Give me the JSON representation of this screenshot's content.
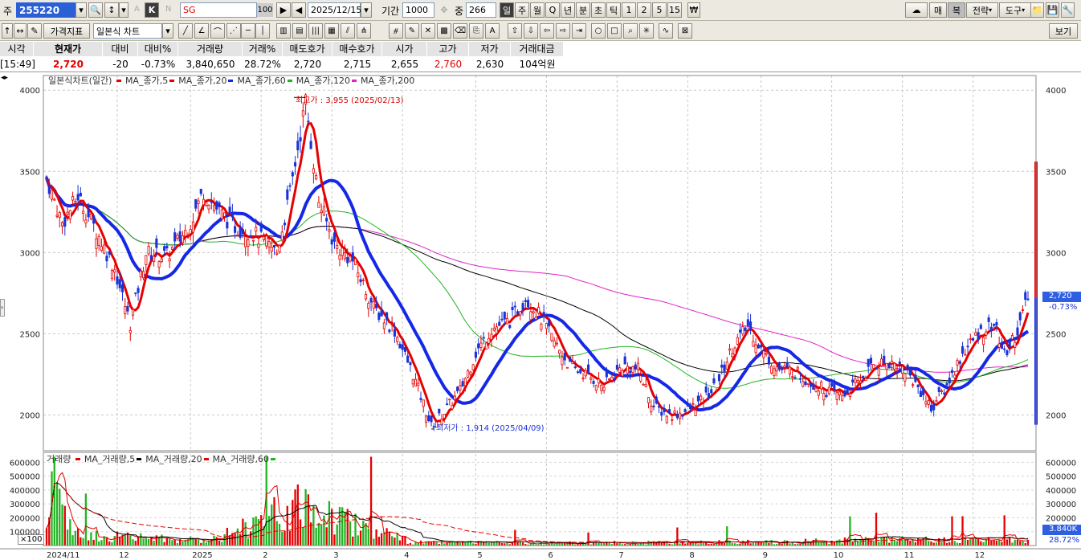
{
  "toolbar": {
    "market_label": "주",
    "code": "255220",
    "k_label": "K",
    "a_label": "A",
    "n_label": "N",
    "stock_name": "SG",
    "name_count": "100",
    "date": "2025/12/15",
    "period_label": "기간",
    "period": "1000",
    "middle_label": "중",
    "middle_value": "266",
    "periods": [
      "일",
      "주",
      "월",
      "Q",
      "년",
      "분",
      "초",
      "틱",
      "1",
      "2",
      "5",
      "15"
    ],
    "right_buttons": [
      "매",
      "복",
      "전략",
      "도구"
    ],
    "price_indicator_btn": "가격지표",
    "chart_type": "일본식 차트",
    "view_btn": "보기"
  },
  "quote": {
    "headers": [
      "시각",
      "현재가",
      "대비",
      "대비%",
      "거래량",
      "거래%",
      "매도호가",
      "매수호가",
      "시가",
      "고가",
      "저가",
      "거래대금"
    ],
    "values": [
      "[15:49]",
      "2,720",
      "-20",
      "-0.73%",
      "3,840,650",
      "28.72%",
      "2,720",
      "2,715",
      "2,655",
      "2,760",
      "2,630",
      "104억원"
    ]
  },
  "legend": {
    "title": "일본식차트(일간)",
    "items": [
      {
        "label": "MA_종가,5",
        "color": "#e60000"
      },
      {
        "label": "MA_종가,20",
        "color": "#e60000"
      },
      {
        "label": "MA_종가,60",
        "color": "#1428e6"
      },
      {
        "label": "MA_종가,120",
        "color": "#22b422"
      },
      {
        "label": "MA_종가,200",
        "color": "#e020c8"
      }
    ]
  },
  "volume_legend": {
    "title": "거래량",
    "items": [
      {
        "label": "MA_거래량,5",
        "color": "#e60000"
      },
      {
        "label": "MA_거래량,20",
        "color": "#000000"
      },
      {
        "label": "MA_거래량,60",
        "color": "#e60000"
      },
      {
        "label": "",
        "color": "#22b422"
      }
    ]
  },
  "annotations": {
    "high": "최고가 : 3,955 (2025/02/13)",
    "low": "최저가 : 1,914 (2025/04/09)"
  },
  "price_badge": {
    "value": "2,720",
    "change": "-0.73%"
  },
  "volume_badge": {
    "value": "3.840K",
    "change": "28.72%"
  },
  "volume_unit": "×100",
  "chart_data": {
    "type": "candlestick",
    "price_axis": {
      "ticks": [
        4000,
        3500,
        3000,
        2500,
        2000
      ],
      "ylim": [
        1780,
        4090
      ]
    },
    "volume_axis": {
      "ticks": [
        "600000",
        "500000",
        "400000",
        "300000",
        "200000",
        "100000"
      ],
      "ylim": [
        0,
        660000
      ]
    },
    "x_labels": [
      "2024/11",
      "12",
      "2025",
      "2",
      "3",
      "4",
      "5",
      "6",
      "7",
      "8",
      "9",
      "10",
      "11",
      "12"
    ],
    "close_anchors": [
      [
        0,
        3460
      ],
      [
        6,
        3180
      ],
      [
        12,
        3350
      ],
      [
        20,
        3100
      ],
      [
        26,
        2900
      ],
      [
        32,
        2560
      ],
      [
        38,
        3000
      ],
      [
        46,
        2980
      ],
      [
        54,
        3150
      ],
      [
        60,
        3380
      ],
      [
        66,
        3250
      ],
      [
        72,
        3160
      ],
      [
        79,
        3120
      ],
      [
        88,
        3000
      ],
      [
        93,
        3360
      ],
      [
        99,
        3930
      ],
      [
        104,
        3320
      ],
      [
        110,
        3050
      ],
      [
        117,
        2950
      ],
      [
        125,
        2660
      ],
      [
        133,
        2520
      ],
      [
        140,
        2250
      ],
      [
        147,
        1930
      ],
      [
        152,
        2020
      ],
      [
        158,
        2150
      ],
      [
        164,
        2380
      ],
      [
        170,
        2530
      ],
      [
        177,
        2580
      ],
      [
        183,
        2720
      ],
      [
        188,
        2620
      ],
      [
        194,
        2450
      ],
      [
        200,
        2300
      ],
      [
        206,
        2250
      ],
      [
        213,
        2180
      ],
      [
        220,
        2300
      ],
      [
        226,
        2280
      ],
      [
        232,
        2050
      ],
      [
        238,
        2000
      ],
      [
        244,
        2020
      ],
      [
        250,
        2080
      ],
      [
        256,
        2180
      ],
      [
        262,
        2420
      ],
      [
        268,
        2550
      ],
      [
        274,
        2380
      ],
      [
        280,
        2280
      ],
      [
        286,
        2270
      ],
      [
        292,
        2200
      ],
      [
        298,
        2150
      ],
      [
        304,
        2120
      ],
      [
        310,
        2200
      ],
      [
        316,
        2310
      ],
      [
        322,
        2330
      ],
      [
        328,
        2280
      ],
      [
        334,
        2150
      ],
      [
        338,
        2040
      ],
      [
        344,
        2180
      ],
      [
        350,
        2380
      ],
      [
        356,
        2500
      ],
      [
        362,
        2560
      ],
      [
        366,
        2370
      ],
      [
        371,
        2520
      ],
      [
        375,
        2720
      ]
    ],
    "volume_anchors": [
      [
        0,
        150000
      ],
      [
        3,
        650000
      ],
      [
        10,
        90000
      ],
      [
        30,
        70000
      ],
      [
        60,
        40000
      ],
      [
        99,
        320000
      ],
      [
        140,
        25000
      ],
      [
        200,
        20000
      ],
      [
        280,
        30000
      ],
      [
        320,
        45000
      ],
      [
        375,
        40000
      ]
    ],
    "ma_periods": [
      5,
      20,
      60,
      120,
      200
    ]
  }
}
